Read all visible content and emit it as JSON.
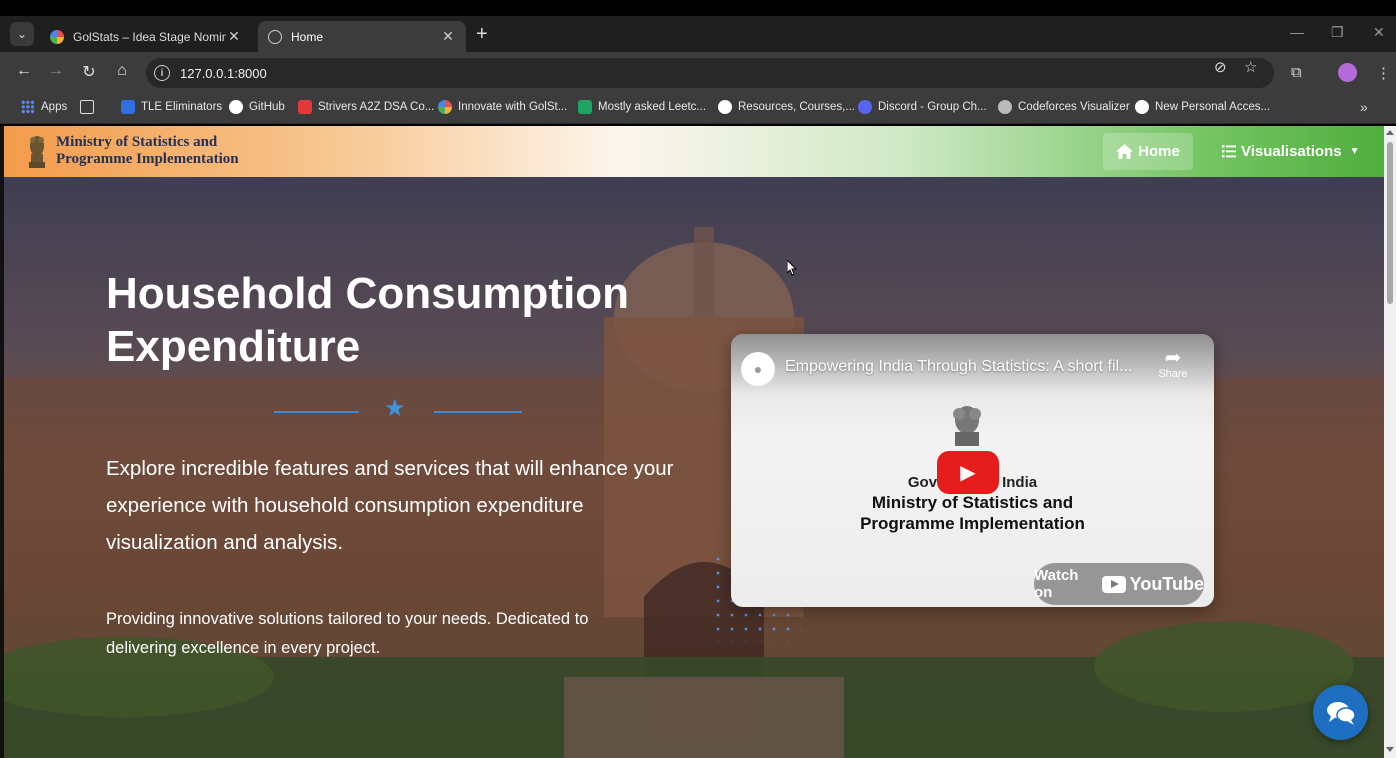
{
  "browser": {
    "tabs": [
      {
        "title": "GolStats – Idea Stage Nominati",
        "active": false
      },
      {
        "title": "Home",
        "active": true
      }
    ],
    "url": "127.0.0.1:8000",
    "bookmarks": [
      {
        "label": "Apps",
        "icon": "apps-grid-icon",
        "color": "#5b8cff"
      },
      {
        "label": "TLE Eliminators",
        "icon": "tle-icon",
        "color": "#2f6fe0"
      },
      {
        "label": "GitHub",
        "icon": "github-icon",
        "color": "#ffffff"
      },
      {
        "label": "Strivers A2Z DSA Co...",
        "icon": "tuf-icon",
        "color": "#e23a3a"
      },
      {
        "label": "Innovate with GolSt...",
        "icon": "golstats-icon",
        "color": "#e0a030"
      },
      {
        "label": "Mostly asked Leetc...",
        "icon": "sheets-icon",
        "color": "#1fa463"
      },
      {
        "label": "Resources, Courses,...",
        "icon": "google-icon",
        "color": "#ffffff"
      },
      {
        "label": "Discord - Group Ch...",
        "icon": "discord-icon",
        "color": "#5865f2"
      },
      {
        "label": "Codeforces Visualizer",
        "icon": "globe-icon",
        "color": "#bbbbbb"
      },
      {
        "label": "New Personal Acces...",
        "icon": "github-icon",
        "color": "#ffffff"
      }
    ]
  },
  "site": {
    "brand_line1": "Ministry of Statistics and",
    "brand_line2": "Programme Implementation",
    "nav_home": "Home",
    "nav_visualisations": "Visualisations"
  },
  "hero": {
    "title": "Household Consumption Expenditure",
    "text": "Explore incredible features and services that will enhance your experience with household consumption expenditure visualization and analysis.",
    "subtext": "Providing innovative solutions tailored to your needs. Dedicated to delivering excellence in every project."
  },
  "video": {
    "title": "Empowering India Through Statistics: A short fil...",
    "share_label": "Share",
    "line1": "Government of India",
    "line1_visible": "Gover          f India",
    "line2": "Ministry of Statistics and Programme Implementation",
    "watch_label": "Watch on",
    "youtube_label": "YouTube"
  }
}
